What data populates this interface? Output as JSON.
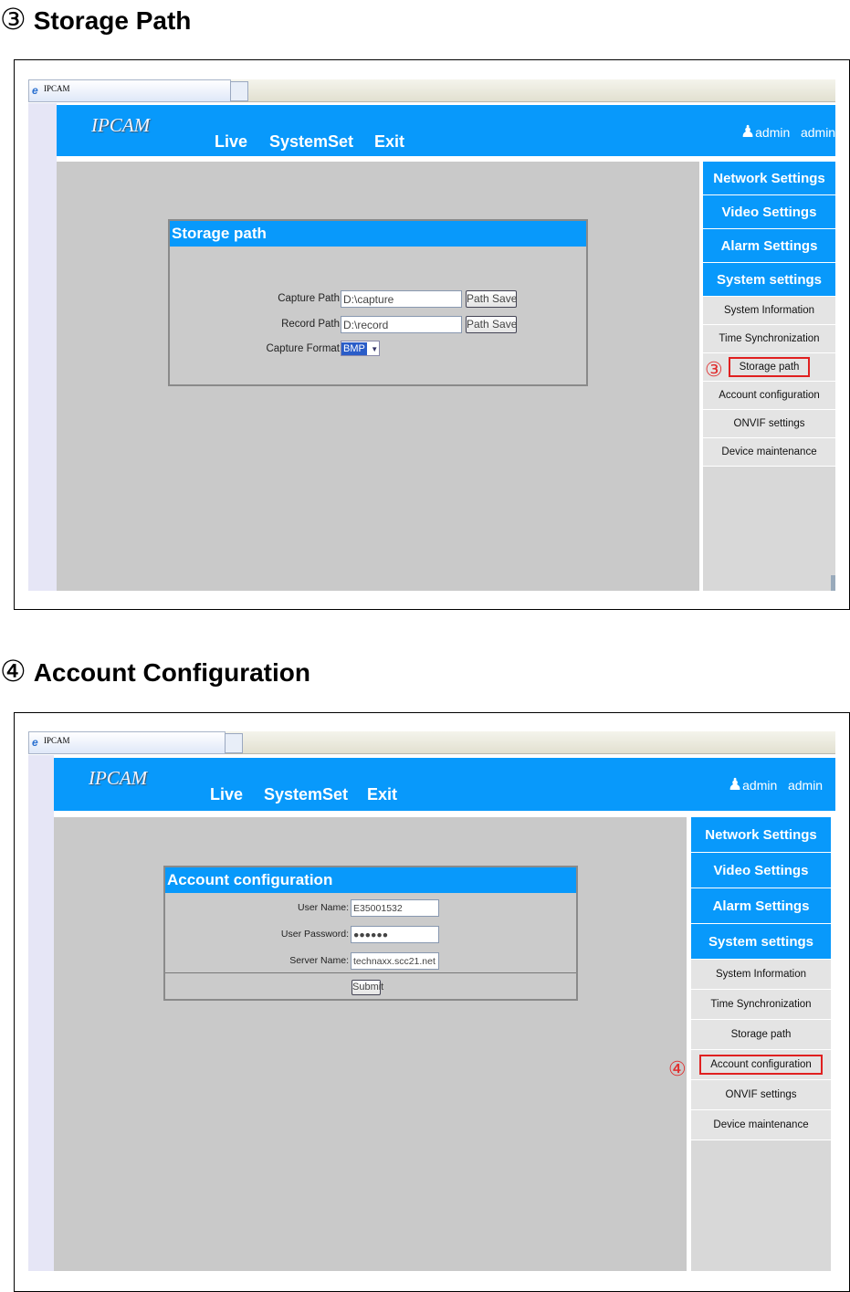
{
  "sections": [
    {
      "number": "③",
      "title": "Storage Path",
      "browser_tab": "IPCAM",
      "logo": "IPCAM",
      "nav": [
        "Live",
        "SystemSet",
        "Exit"
      ],
      "user": [
        "admin",
        "admin"
      ],
      "sidebar_main": [
        "Network Settings",
        "Video Settings",
        "Alarm Settings",
        "System settings"
      ],
      "sidebar_sub": [
        "System Information",
        "Time Synchronization",
        "Storage path",
        "Account configuration",
        "ONVIF settings",
        "Device maintenance"
      ],
      "highlighted_index": 2,
      "marker": "③",
      "dialog": {
        "title": "Storage path",
        "fields": [
          {
            "label": "Capture Path",
            "value": "D:\\capture",
            "button": "Path Save"
          },
          {
            "label": "Record Path",
            "value": "D:\\record",
            "button": "Path Save"
          }
        ],
        "format_label": "Capture Format",
        "format_value": "BMP"
      }
    },
    {
      "number": "④",
      "title": "Account Configuration",
      "browser_tab": "IPCAM",
      "logo": "IPCAM",
      "nav": [
        "Live",
        "SystemSet",
        "Exit"
      ],
      "user": [
        "admin",
        "admin"
      ],
      "sidebar_main": [
        "Network Settings",
        "Video Settings",
        "Alarm Settings",
        "System settings"
      ],
      "sidebar_sub": [
        "System Information",
        "Time Synchronization",
        "Storage path",
        "Account configuration",
        "ONVIF settings",
        "Device maintenance"
      ],
      "highlighted_index": 3,
      "marker": "④",
      "dialog": {
        "title": "Account configuration",
        "fields": [
          {
            "label": "User Name:",
            "value": "E35001532"
          },
          {
            "label": "User Password:",
            "value": "●●●●●●"
          },
          {
            "label": "Server Name:",
            "value": "technaxx.scc21.net"
          }
        ],
        "submit": "Submit"
      }
    }
  ],
  "colors": {
    "header_blue": "#0899fb",
    "content_gray": "#c9c9c9",
    "highlight_red": "#e02020"
  }
}
